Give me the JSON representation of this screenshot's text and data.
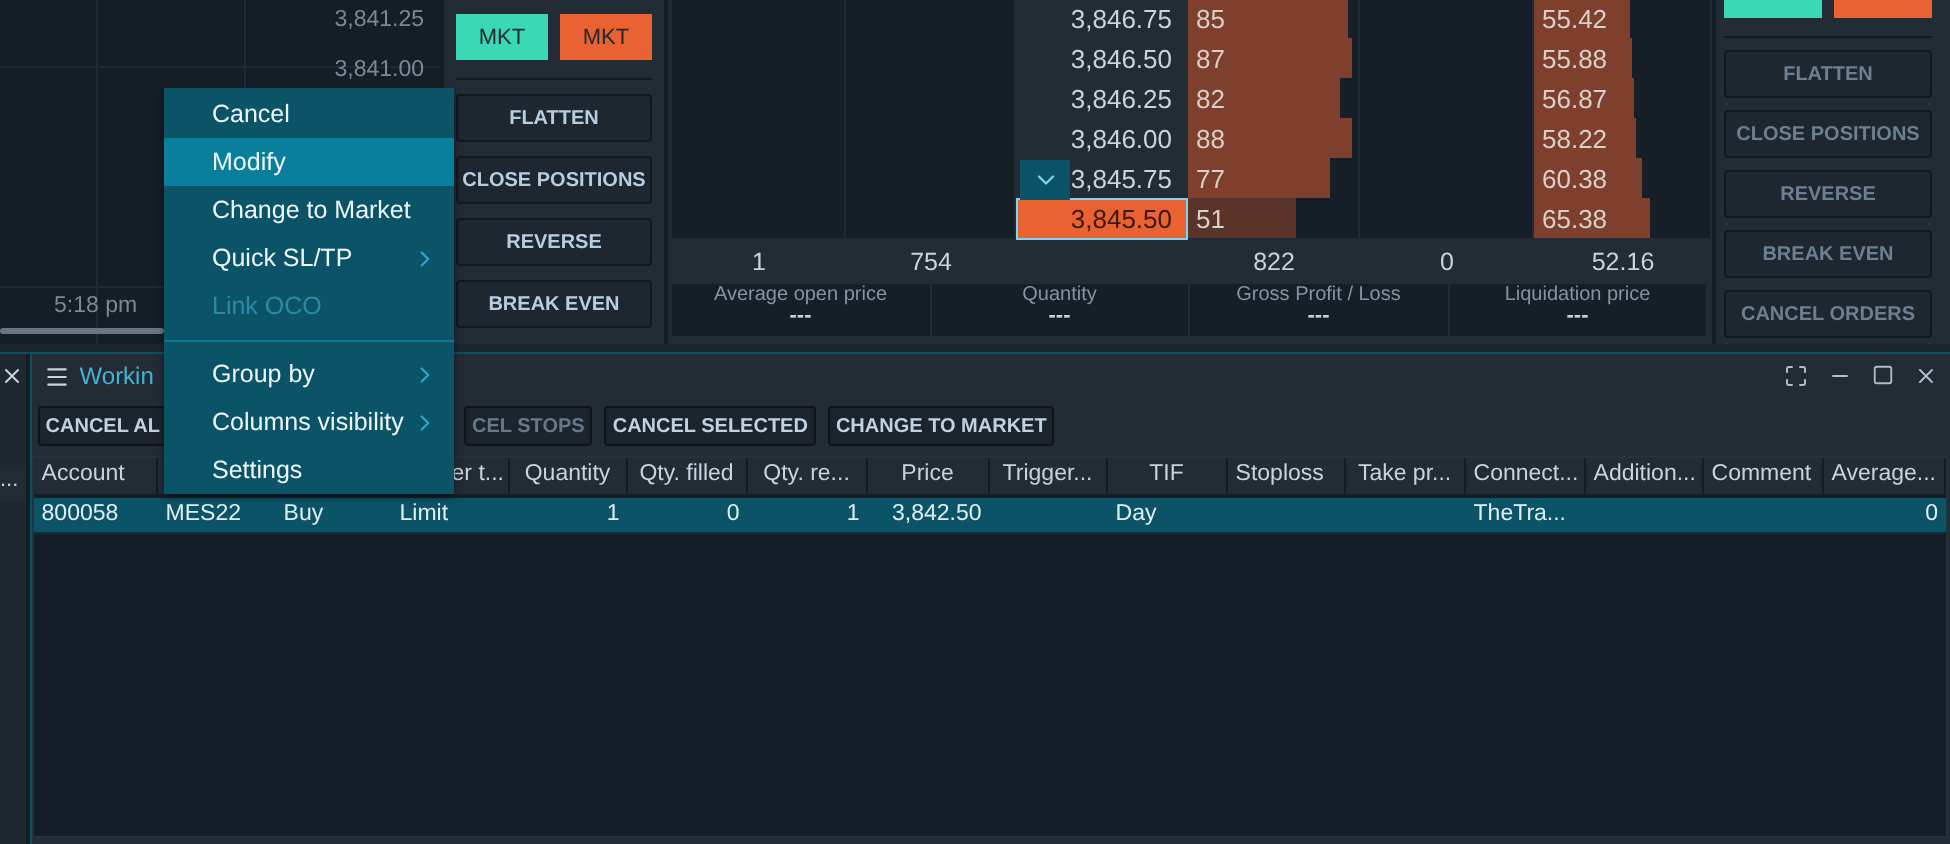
{
  "chart": {
    "price_labels": [
      "3,841.25",
      "3,841.00"
    ],
    "time_label": "5:18 pm"
  },
  "order_panel": {
    "market": [
      {
        "label": "MKT",
        "kind": "buy"
      },
      {
        "label": "MKT",
        "kind": "sell"
      }
    ],
    "actions": [
      {
        "label": "FLATTEN",
        "disabled": false
      },
      {
        "label": "CLOSE POSITIONS",
        "disabled": false
      },
      {
        "label": "REVERSE",
        "disabled": false
      },
      {
        "label": "BREAK EVEN",
        "disabled": false
      }
    ]
  },
  "dom": {
    "rows": [
      {
        "price": "3,846.75",
        "selected": false,
        "size": {
          "text": "85",
          "level": 0.94
        },
        "value": {
          "text": "55.42",
          "level": 0.55
        }
      },
      {
        "price": "3,846.50",
        "selected": false,
        "size": {
          "text": "87",
          "level": 0.96
        },
        "value": {
          "text": "55.88",
          "level": 0.56
        }
      },
      {
        "price": "3,846.25",
        "selected": false,
        "size": {
          "text": "82",
          "level": 0.89
        },
        "value": {
          "text": "56.87",
          "level": 0.57
        }
      },
      {
        "price": "3,846.00",
        "selected": false,
        "size": {
          "text": "88",
          "level": 0.97
        },
        "value": {
          "text": "58.22",
          "level": 0.58
        }
      },
      {
        "price": "3,845.75",
        "selected": false,
        "size": {
          "text": "77",
          "level": 0.84
        },
        "value": {
          "text": "60.38",
          "level": 0.61
        }
      },
      {
        "price": "3,845.50",
        "selected": true,
        "size": {
          "text": "51",
          "level": 0.64
        },
        "value": {
          "text": "65.38",
          "level": 0.66
        }
      }
    ],
    "summary": {
      "column_1": "1",
      "column_2": "754",
      "column_4": "822",
      "column_5": "0",
      "column_6": "52.16"
    },
    "stats": [
      {
        "label": "Average open price",
        "value": "---"
      },
      {
        "label": "Quantity",
        "value": "---"
      },
      {
        "label": "Gross Profit / Loss",
        "value": "---"
      },
      {
        "label": "Liquidation price",
        "value": "---"
      }
    ]
  },
  "side_panel": {
    "market": [
      {
        "kind": "buy"
      },
      {
        "kind": "sell"
      }
    ],
    "actions": [
      {
        "label": "FLATTEN",
        "disabled": true
      },
      {
        "label": "CLOSE POSITIONS",
        "disabled": true
      },
      {
        "label": "REVERSE",
        "disabled": true
      },
      {
        "label": "BREAK EVEN",
        "disabled": true
      },
      {
        "label": "CANCEL ORDERS",
        "disabled": true
      }
    ]
  },
  "left_panel": {
    "column": "..."
  },
  "working_orders": {
    "title": "Workin",
    "toolbar": [
      {
        "label": "CANCEL AL",
        "disabled": false
      },
      {
        "label": "CEL STOPS",
        "disabled": true
      },
      {
        "label": "CANCEL SELECTED",
        "disabled": false
      },
      {
        "label": "CHANGE TO MARKET",
        "disabled": false
      }
    ],
    "columns": [
      "Account",
      "",
      "",
      "er t...",
      "Quantity",
      "Qty. filled",
      "Qty. re...",
      "Price",
      "Trigger...",
      "TIF",
      "Stoploss",
      "Take pr...",
      "Connect...",
      "Addition...",
      "Comment",
      "Average..."
    ],
    "rows": [
      {
        "selected": true,
        "cells": [
          "800058",
          "MES22",
          "Buy",
          "Limit",
          "1",
          "0",
          "1",
          "3,842.50",
          "",
          "Day",
          "",
          "",
          "TheTra...",
          "",
          "",
          "0"
        ]
      }
    ]
  },
  "context_menu": {
    "items": [
      {
        "kind": "item",
        "label": "Cancel",
        "selected": false,
        "disabled": false,
        "submenu": false
      },
      {
        "kind": "item",
        "label": "Modify",
        "selected": true,
        "disabled": false,
        "submenu": false
      },
      {
        "kind": "item",
        "label": "Change to Market",
        "selected": false,
        "disabled": false,
        "submenu": false
      },
      {
        "kind": "item",
        "label": "Quick SL/TP",
        "selected": false,
        "disabled": false,
        "submenu": true
      },
      {
        "kind": "item",
        "label": "Link OCO",
        "selected": false,
        "disabled": true,
        "submenu": false
      },
      {
        "kind": "separator"
      },
      {
        "kind": "item",
        "label": "Group by",
        "selected": false,
        "disabled": false,
        "submenu": true
      },
      {
        "kind": "item",
        "label": "Columns visibility",
        "selected": false,
        "disabled": false,
        "submenu": true
      },
      {
        "kind": "item",
        "label": "Settings",
        "selected": false,
        "disabled": false,
        "submenu": false
      }
    ]
  }
}
